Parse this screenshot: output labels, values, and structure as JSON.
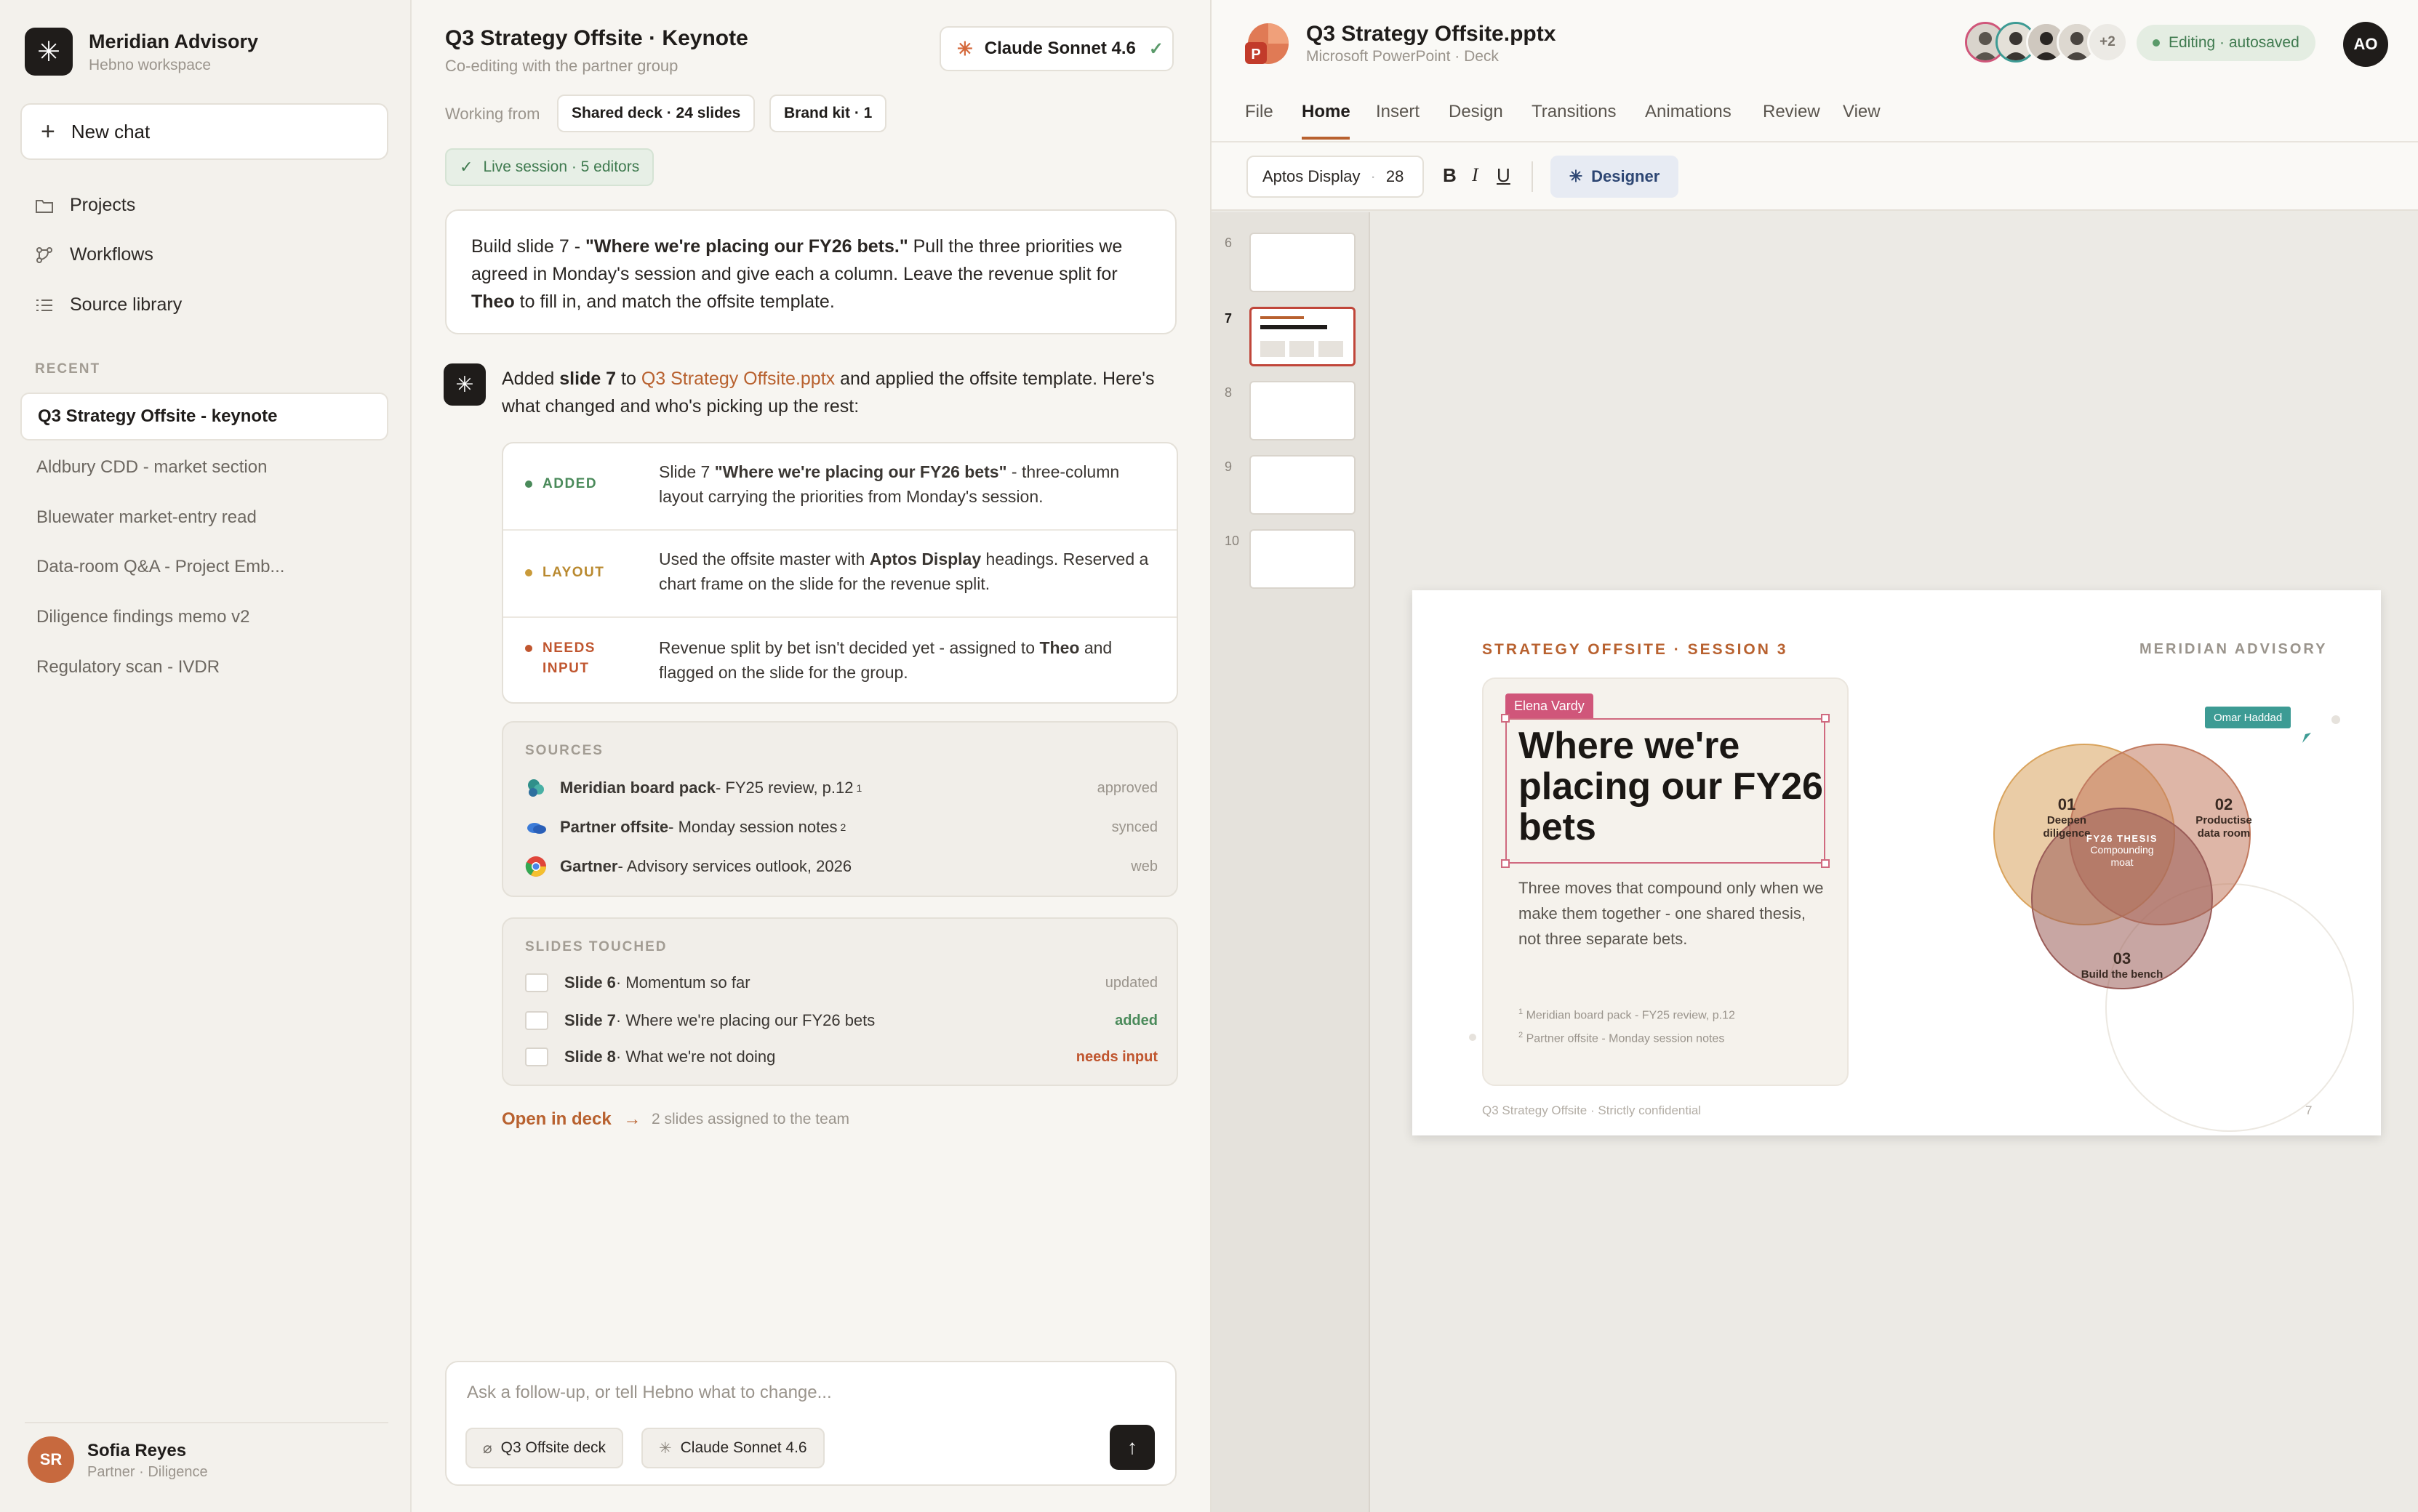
{
  "sidebar": {
    "org_name": "Meridian Advisory",
    "org_sub": "Hebno workspace",
    "new_chat": "New chat",
    "nav": [
      "Projects",
      "Workflows",
      "Source library"
    ],
    "recent_heading": "RECENT",
    "recent": [
      "Q3 Strategy Offsite - keynote",
      "Aldbury CDD - market section",
      "Bluewater market-entry read",
      "Data-room Q&A - Project Emb...",
      "Diligence findings memo v2",
      "Regulatory scan - IVDR"
    ],
    "user": {
      "initials": "SR",
      "name": "Sofia Reyes",
      "role": "Partner · Diligence"
    }
  },
  "chat": {
    "title": "Q3 Strategy Offsite · Keynote",
    "subtitle": "Co-editing with the partner group",
    "model": "Claude Sonnet 4.6",
    "working_from": "Working from",
    "chips": [
      "Shared deck · 24 slides",
      "Brand kit · 1"
    ],
    "live": "Live session · 5 editors",
    "prompt": {
      "p1": "Build slide 7 - ",
      "p1b": "\"Where we're placing our FY26 bets.\"",
      "p2": " Pull the three priorities we agreed in Monday's session and give each a column. Leave the revenue split for ",
      "p2b": "Theo",
      "p3": " to fill in, and match the offsite template."
    },
    "reply": {
      "a1": "Added ",
      "a1b": "slide 7",
      "a2": " to ",
      "a2link": "Q3 Strategy Offsite.pptx",
      "a3": " and applied the offsite template. Here's what changed and who's picking up the rest:"
    },
    "changes": [
      {
        "tag": "ADDED",
        "t1": "Slide 7 ",
        "t1b": "\"Where we're placing our FY26 bets\"",
        "t2": " - three-column layout carrying the priorities from Monday's session.",
        "t2b": "",
        "t3": ""
      },
      {
        "tag": "LAYOUT",
        "t1": "Used the offsite master with ",
        "t1b": "Aptos Display",
        "t2": " headings. Reserved a chart frame on the slide for the revenue split.",
        "t2b": "",
        "t3": ""
      },
      {
        "tag": "NEEDS INPUT",
        "t1": "Revenue split by bet isn't decided yet - assigned to ",
        "t1b": "Theo",
        "t2": " and flagged on the slide for the group.",
        "t2b": "",
        "t3": ""
      }
    ],
    "sources_heading": "SOURCES",
    "sources": [
      {
        "name": "Meridian board pack",
        "detail": " - FY25 review, p.12",
        "sup": "1",
        "status": "approved"
      },
      {
        "name": "Partner offsite",
        "detail": " - Monday session notes",
        "sup": "2",
        "status": "synced"
      },
      {
        "name": "Gartner",
        "detail": " - Advisory services outlook, 2026",
        "sup": "",
        "status": "web"
      }
    ],
    "slides_heading": "SLIDES TOUCHED",
    "slides": [
      {
        "name": "Slide 6",
        "detail": " · Momentum so far",
        "status": "updated"
      },
      {
        "name": "Slide 7",
        "detail": " · Where we're placing our FY26 bets",
        "status": "added"
      },
      {
        "name": "Slide 8",
        "detail": " · What we're not doing",
        "status": "needs input"
      }
    ],
    "open_deck": "Open in deck",
    "assigned": "2 slides assigned to the team",
    "composer_placeholder": "Ask a follow-up, or tell Hebno what to change...",
    "composer_chips": [
      "Q3 Offsite deck",
      "Claude Sonnet 4.6"
    ]
  },
  "ppt": {
    "title": "Q3 Strategy Offsite.pptx",
    "subtitle": "Microsoft PowerPoint · Deck",
    "more_editors": "+2",
    "status": "Editing · autosaved",
    "user_initials": "AO",
    "menu": [
      "File",
      "Home",
      "Insert",
      "Design",
      "Transitions",
      "Animations",
      "Review",
      "View"
    ],
    "font": "Aptos Display",
    "size": "28",
    "bold": "B",
    "italic": "I",
    "underline": "U",
    "designer": "Designer",
    "thumb_numbers": [
      "6",
      "7",
      "8",
      "9",
      "10"
    ],
    "slide": {
      "kicker": "STRATEGY OFFSITE · SESSION 3",
      "brand": "MERIDIAN ADVISORY",
      "editor": "Elena Vardy",
      "heading": "Where we're placing our FY26 bets",
      "body": "Three moves that compound only when we make them together - one shared thesis, not three separate bets.",
      "fn1": "Meridian board pack - FY25 review, p.12",
      "fn2": "Partner offsite - Monday session notes",
      "fn1n": "1",
      "fn2n": "2",
      "footer": "Q3 Strategy Offsite · Strictly confidential",
      "page": "7",
      "cursor_user": "Omar Haddad",
      "venn": [
        {
          "num": "01",
          "label": "Deepen diligence",
          "color": "#d9a35c"
        },
        {
          "num": "02",
          "label": "Productise data room",
          "color": "#c27a5f"
        },
        {
          "num": "03",
          "label": "Build the bench",
          "color": "#9a5c58"
        }
      ],
      "thesis_title": "FY26 THESIS",
      "thesis_body": "Compounding moat"
    }
  },
  "colors": {
    "accent": "#b8612f",
    "added": "#4a8a5a",
    "layout": "#b9892f",
    "needs": "#c0562f"
  }
}
